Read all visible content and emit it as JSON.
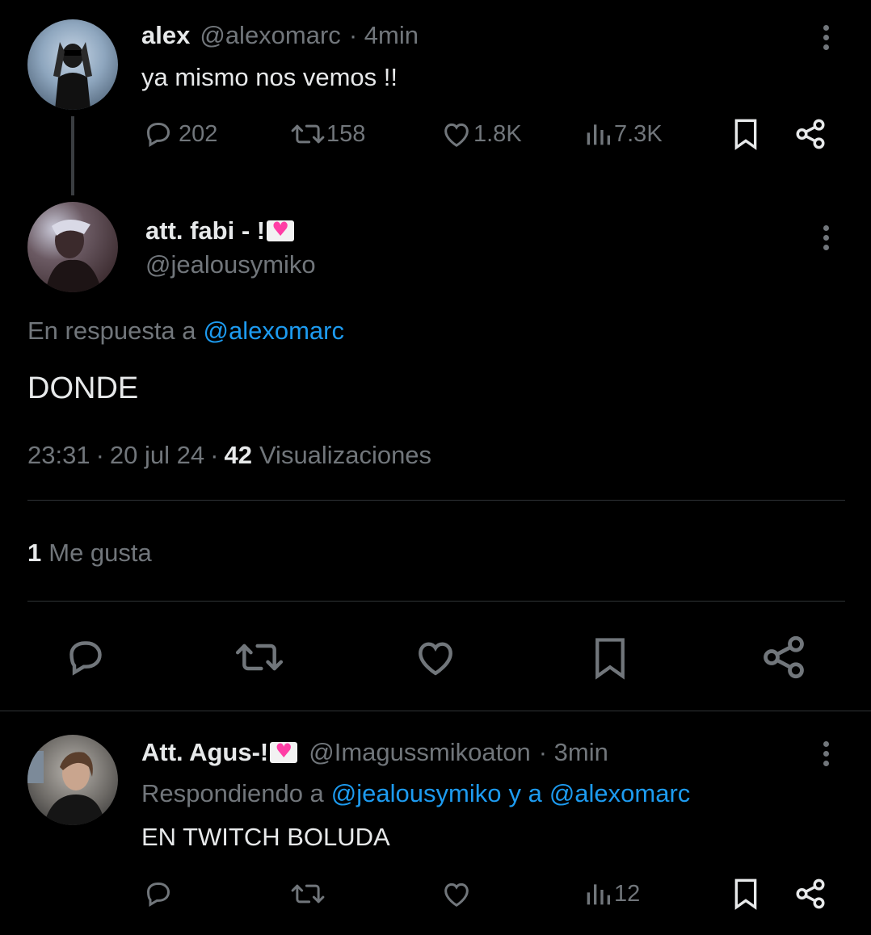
{
  "tweet1": {
    "name": "alex",
    "handle": "@alexomarc",
    "time": "· 4min",
    "text": "ya mismo nos vemos !!",
    "replies": "202",
    "retweets": "158",
    "likes": "1.8K",
    "views": "7.3K"
  },
  "tweet2": {
    "name": "att. fabi - !",
    "handle": "@jealousymiko",
    "reply_prefix": "En respuesta a",
    "reply_to": "@alexomarc",
    "text": "DONDE",
    "time": "23:31",
    "date": "20 jul 24",
    "views_count": "42",
    "views_label": "Visualizaciones",
    "likes_count": "1",
    "likes_label": "Me gusta"
  },
  "tweet3": {
    "name": "Att. Agus-!",
    "handle": "@Imagussmikoaton",
    "time": "· 3min",
    "reply_prefix": "Respondiendo a",
    "reply_to_1": "@jealousymiko",
    "reply_join": "y a",
    "reply_to_2": "@alexomarc",
    "text": "EN TWITCH BOLUDA",
    "views": "12"
  },
  "icons": {
    "reply": "reply-icon",
    "retweet": "retweet-icon",
    "like": "heart-icon",
    "views": "views-icon",
    "bookmark": "bookmark-icon",
    "share": "share-icon",
    "more": "more-icon"
  },
  "colors": {
    "background": "#000000",
    "text": "#e7e9ea",
    "secondary": "#71767b",
    "link": "#1d9bf0",
    "divider": "#2f3336"
  }
}
